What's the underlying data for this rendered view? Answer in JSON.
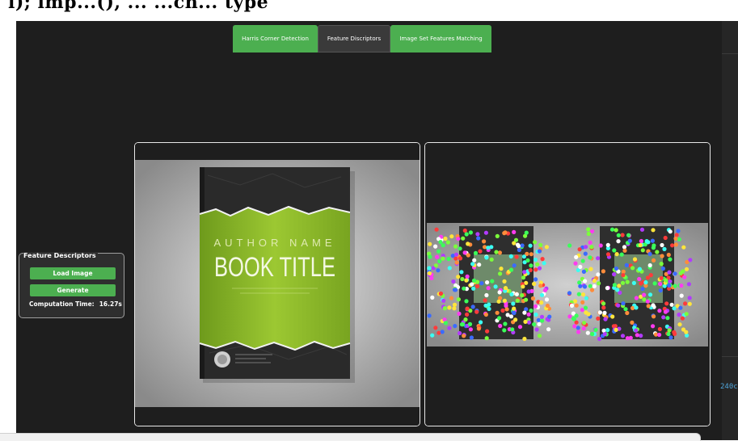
{
  "header": {
    "text": "i); imp...(), ... ...ch... type"
  },
  "tabs": [
    {
      "label": "Harris Corner Detection",
      "active": false
    },
    {
      "label": "Feature Discriptors",
      "active": true
    },
    {
      "label": "Image Set Features Matching",
      "active": false
    }
  ],
  "panel": {
    "title": "Feature Descriptors",
    "load_label": "Load Image",
    "generate_label": "Generate",
    "computation_label": "Computation Time:",
    "computation_value": "16.27s"
  },
  "book": {
    "author": "AUTHOR NAME",
    "title": "BOOK TITLE"
  },
  "side": {
    "text": "240c"
  },
  "colors": {
    "accent": "#4caf50",
    "app_bg": "#1e1e1e",
    "panel_bg": "#2e2e2e",
    "book_green": "#8dbb2a"
  }
}
